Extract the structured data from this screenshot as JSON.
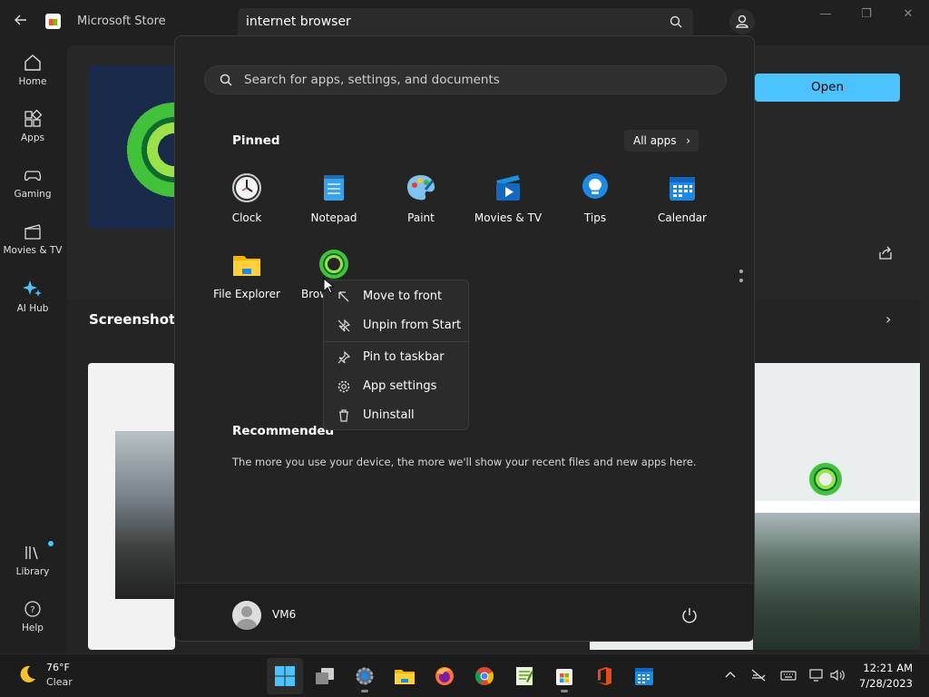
{
  "store": {
    "title": "Microsoft Store",
    "search_value": "internet browser",
    "open_button": "Open",
    "screenshots_heading": "Screenshots",
    "nav": [
      {
        "label": "Home",
        "icon": "home-icon"
      },
      {
        "label": "Apps",
        "icon": "apps-icon"
      },
      {
        "label": "Gaming",
        "icon": "gaming-icon"
      },
      {
        "label": "Movies & TV",
        "icon": "movies-icon"
      },
      {
        "label": "AI Hub",
        "icon": "ai-hub-icon"
      },
      {
        "label": "Library",
        "icon": "library-icon"
      },
      {
        "label": "Help",
        "icon": "help-icon"
      }
    ]
  },
  "start_menu": {
    "search_placeholder": "Search for apps, settings, and documents",
    "pinned_heading": "Pinned",
    "all_apps_label": "All apps",
    "pinned_apps": [
      {
        "label": "Clock",
        "icon": "clock-icon"
      },
      {
        "label": "Notepad",
        "icon": "notepad-icon"
      },
      {
        "label": "Paint",
        "icon": "paint-icon"
      },
      {
        "label": "Movies & TV",
        "icon": "movies-tv-icon"
      },
      {
        "label": "Tips",
        "icon": "tips-icon"
      },
      {
        "label": "Calendar",
        "icon": "calendar-icon"
      },
      {
        "label": "File Explorer",
        "icon": "file-explorer-icon"
      },
      {
        "label": "Brow",
        "icon": "browser-icon"
      }
    ],
    "recommended_heading": "Recommended",
    "recommended_text": "The more you use your device, the more we'll show your recent files and new apps here.",
    "user_name": "VM6"
  },
  "context_menu": {
    "items": [
      {
        "label": "Move to front",
        "icon": "move-to-front-icon"
      },
      {
        "label": "Unpin from Start",
        "icon": "unpin-icon"
      },
      {
        "label": "Pin to taskbar",
        "icon": "pin-icon"
      },
      {
        "label": "App settings",
        "icon": "gear-icon"
      },
      {
        "label": "Uninstall",
        "icon": "trash-icon"
      }
    ]
  },
  "taskbar": {
    "weather_temp": "76°F",
    "weather_condition": "Clear",
    "time": "12:21 AM",
    "date": "7/28/2023",
    "apps": [
      "start-icon",
      "task-view-icon",
      "settings-icon",
      "file-explorer-icon",
      "firefox-icon",
      "chrome-icon",
      "notepad-plus-icon",
      "store-icon",
      "office-icon",
      "calendar-icon"
    ]
  },
  "colors": {
    "accent": "#4cc2ff",
    "brand_green": "#42c23a"
  }
}
